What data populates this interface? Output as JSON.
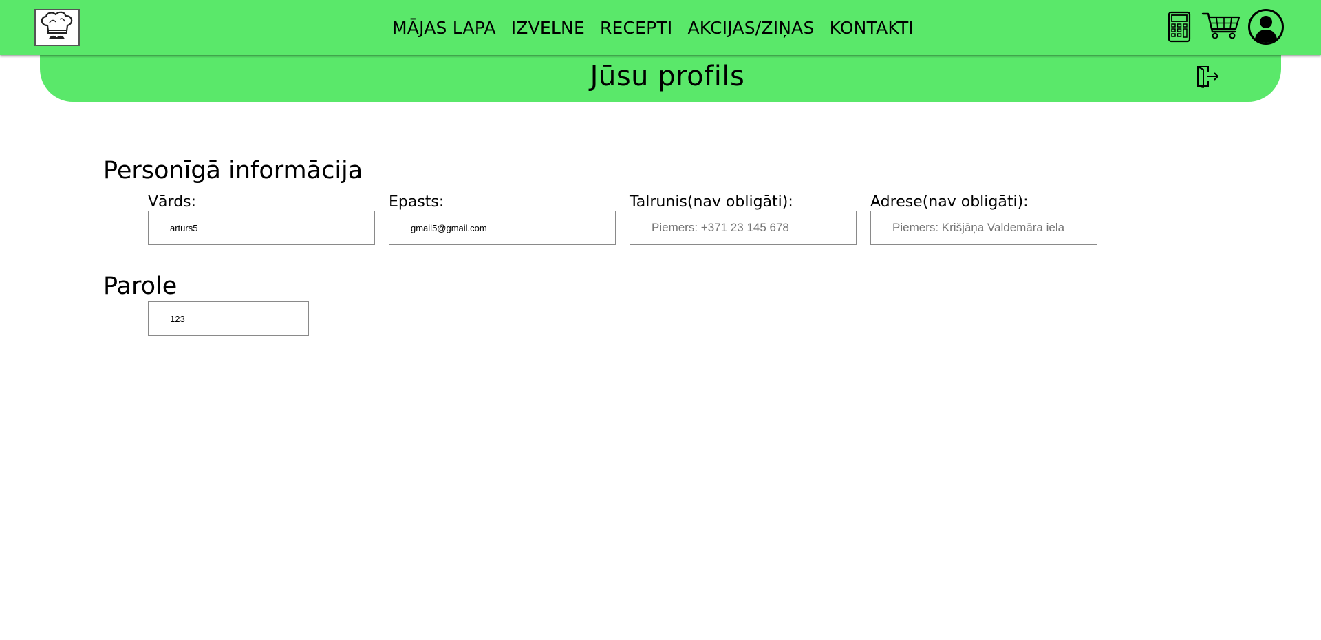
{
  "nav": {
    "links": [
      "MĀJAS LAPA",
      "IZVELNE",
      "RECEPTI",
      "AKCIJAS/ZIŅAS",
      "KONTAKTI"
    ]
  },
  "banner": {
    "title": "Jūsu profils"
  },
  "personal": {
    "title": "Personīgā informācija",
    "name_label": "Vārds:",
    "name_value": "arturs5",
    "email_label": "Epasts:",
    "email_value": "gmail5@gmail.com",
    "phone_label": "Talrunis(nav obligāti):",
    "phone_placeholder": "Piemers: +371 23 145 678",
    "address_label": "Adrese(nav obligāti):",
    "address_placeholder": "Piemers: Krišjāņa Valdemāra iela"
  },
  "password": {
    "title": "Parole",
    "value": "123"
  },
  "colors": {
    "accent": "#5ae86a"
  },
  "icons": [
    "chef-logo-icon",
    "calculator-icon",
    "cart-icon",
    "user-account-icon",
    "logout-icon"
  ]
}
